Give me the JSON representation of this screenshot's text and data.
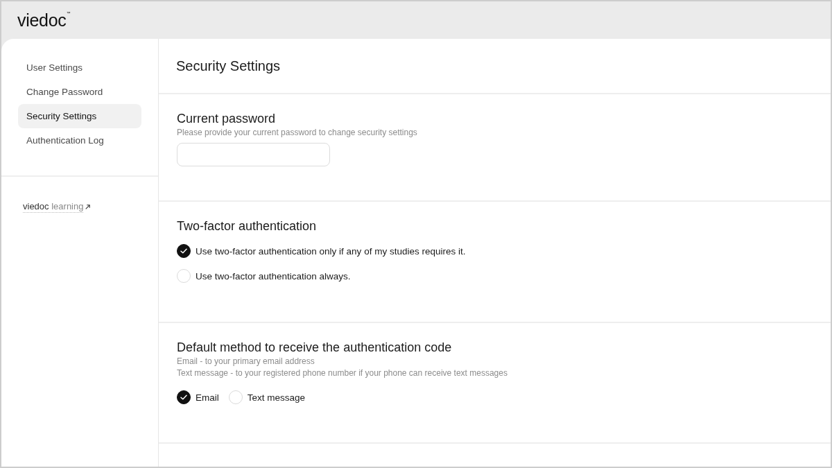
{
  "header": {
    "logo": "viedoc",
    "logo_mark": "™"
  },
  "sidebar": {
    "items": [
      {
        "label": "User Settings",
        "selected": false
      },
      {
        "label": "Change Password",
        "selected": false
      },
      {
        "label": "Security Settings",
        "selected": true
      },
      {
        "label": "Authentication Log",
        "selected": false
      }
    ],
    "link": {
      "brand": "viedoc",
      "label": "learning"
    }
  },
  "page": {
    "title": "Security Settings"
  },
  "sections": [
    {
      "kind": "password",
      "title": "Current password",
      "description": "Please provide your current password to change security settings"
    },
    {
      "kind": "radio_list",
      "title": "Two-factor authentication",
      "options": [
        {
          "label": "Use two-factor authentication only if any of my studies requires it.",
          "selected": true
        },
        {
          "label": "Use two-factor authentication always.",
          "selected": false
        }
      ]
    },
    {
      "kind": "radio_inline",
      "title": "Default method to receive the authentication code",
      "descriptions": [
        "Email - to your primary email address",
        "Text message - to your registered phone number if your phone can receive text messages"
      ],
      "options": [
        {
          "label": "Email",
          "selected": true
        },
        {
          "label": "Text message",
          "selected": false
        }
      ]
    }
  ]
}
